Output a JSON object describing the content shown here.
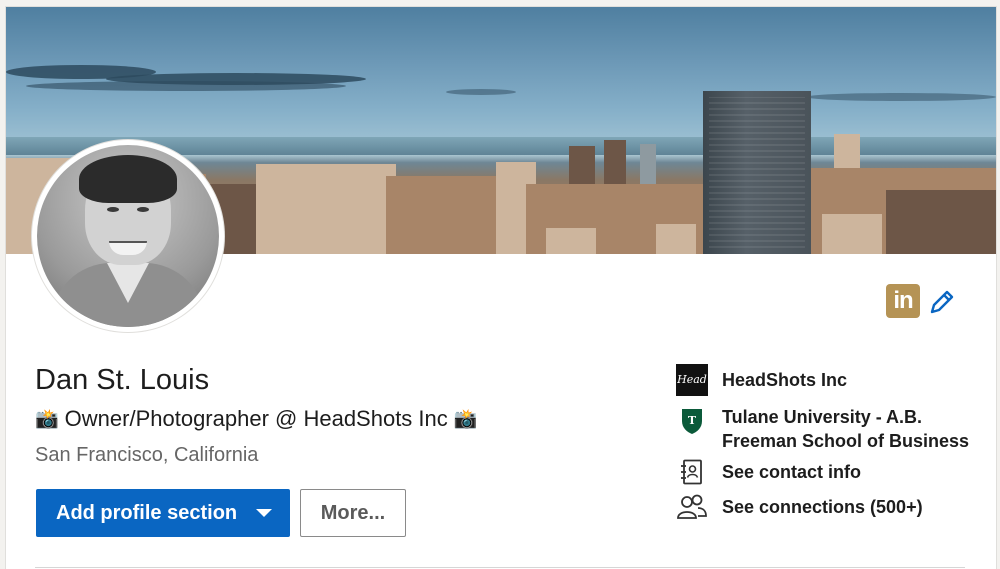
{
  "profile": {
    "name": "Dan St. Louis",
    "headline": "Owner/Photographer @ HeadShots Inc",
    "headline_emoji": "📸",
    "location": "San Francisco, California"
  },
  "badges": {
    "linkedin_text": "in",
    "linkedin_color": "#b59355",
    "edit_icon": "pencil-icon"
  },
  "actions": {
    "primary_label": "Add profile section",
    "secondary_label": "More..."
  },
  "sidebar": {
    "company": {
      "label": "HeadShots Inc",
      "logo_text": "Head"
    },
    "education": {
      "line1": "Tulane University - A.B.",
      "line2": "Freeman School of Business"
    },
    "contact": {
      "label": "See contact info",
      "icon": "address-book-icon"
    },
    "connections": {
      "label": "See connections (500+)",
      "icon": "people-icon"
    }
  },
  "colors": {
    "primary_button": "#0a66c2",
    "link_icon": "#0a66c2"
  }
}
